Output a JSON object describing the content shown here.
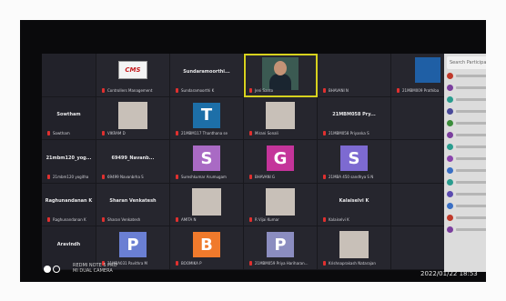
{
  "tiles": [
    {
      "kind": "name",
      "center": "",
      "bottom": ""
    },
    {
      "kind": "logo",
      "logo": "CMS",
      "bottom": "Controllers Management"
    },
    {
      "kind": "name",
      "center": "Sundaramoorthi...",
      "bottom": "Sundaramoorthi K"
    },
    {
      "kind": "person",
      "bottom": "Jeni Santo",
      "active": true
    },
    {
      "kind": "name",
      "center": "",
      "bottom": "BHAVANI N"
    },
    {
      "kind": "blue",
      "bottom": "21MBM009 Prathiba"
    },
    {
      "kind": "name",
      "center": "Sowtham",
      "bottom": "Sowtham"
    },
    {
      "kind": "photo",
      "bottom": "VIKRAM D"
    },
    {
      "kind": "avatar",
      "letter": "T",
      "color": "#1d6fa8",
      "bottom": "21MBM117 Thanthana se"
    },
    {
      "kind": "photo",
      "bottom": "Mirani Sonali"
    },
    {
      "kind": "name",
      "center": "21MBM058 Pry...",
      "bottom": "21MBM058 Priyanka S"
    },
    {
      "kind": "name",
      "center": "",
      "bottom": ""
    },
    {
      "kind": "name",
      "center": "21mbm120_yog...",
      "bottom": "21mbm120 yogitha"
    },
    {
      "kind": "name",
      "center": "69499_Navanb...",
      "bottom": "69499 Navanbrha S"
    },
    {
      "kind": "avatar",
      "letter": "S",
      "color": "#a96ac4",
      "bottom": "Sureshkumar Arumugam"
    },
    {
      "kind": "avatar",
      "letter": "G",
      "color": "#c4349a",
      "bottom": "BHAVANI G"
    },
    {
      "kind": "avatar",
      "letter": "S",
      "color": "#7d6ad1",
      "bottom": "21MBA 450 sandhya S N"
    },
    {
      "kind": "name",
      "center": "",
      "bottom": ""
    },
    {
      "kind": "name",
      "center": "Raghunandanan K",
      "bottom": "Raghunandanan K"
    },
    {
      "kind": "name",
      "center": "Sharan Venkatesh",
      "bottom": "Sharan Venkatesh"
    },
    {
      "kind": "photo",
      "bottom": "AMITA N"
    },
    {
      "kind": "photo",
      "bottom": "R Vijai Kumar"
    },
    {
      "kind": "name",
      "center": "Kalaiselvi K",
      "bottom": "Kalaiselvi K"
    },
    {
      "kind": "name",
      "center": "",
      "bottom": ""
    },
    {
      "kind": "name",
      "center": "Aravindh",
      "bottom": ""
    },
    {
      "kind": "avatar",
      "letter": "P",
      "color": "#6a7fd3",
      "bottom": "21MBA031 Pavithra M"
    },
    {
      "kind": "avatar",
      "letter": "B",
      "color": "#f07a2c",
      "bottom": "BOOMIKA P"
    },
    {
      "kind": "avatar",
      "letter": "P",
      "color": "#8b8dc0",
      "bottom": "21MBM059 Priya Hariharan..."
    },
    {
      "kind": "photo",
      "bottom": "Krishnaprakash Natarajan"
    },
    {
      "kind": "name",
      "center": "",
      "bottom": ""
    }
  ],
  "side_panel": {
    "search_placeholder": "Search Participants"
  },
  "side_colors": [
    "#c0392b",
    "#7b3f9e",
    "#2a9d8f",
    "#4a4a9a",
    "#3c8d3c",
    "#7b3f9e",
    "#2a9d8f",
    "#8b44ad",
    "#3a6fc4",
    "#2a9d8f",
    "#5b4bb0",
    "#3a6fc4",
    "#c0392b",
    "#7b3f9e"
  ],
  "bottom_text": {
    "line1": "REDMI NOTE 5 PRO",
    "line2": "MI DUAL CAMERA"
  },
  "timestamp": "2022/01/22 18:53"
}
